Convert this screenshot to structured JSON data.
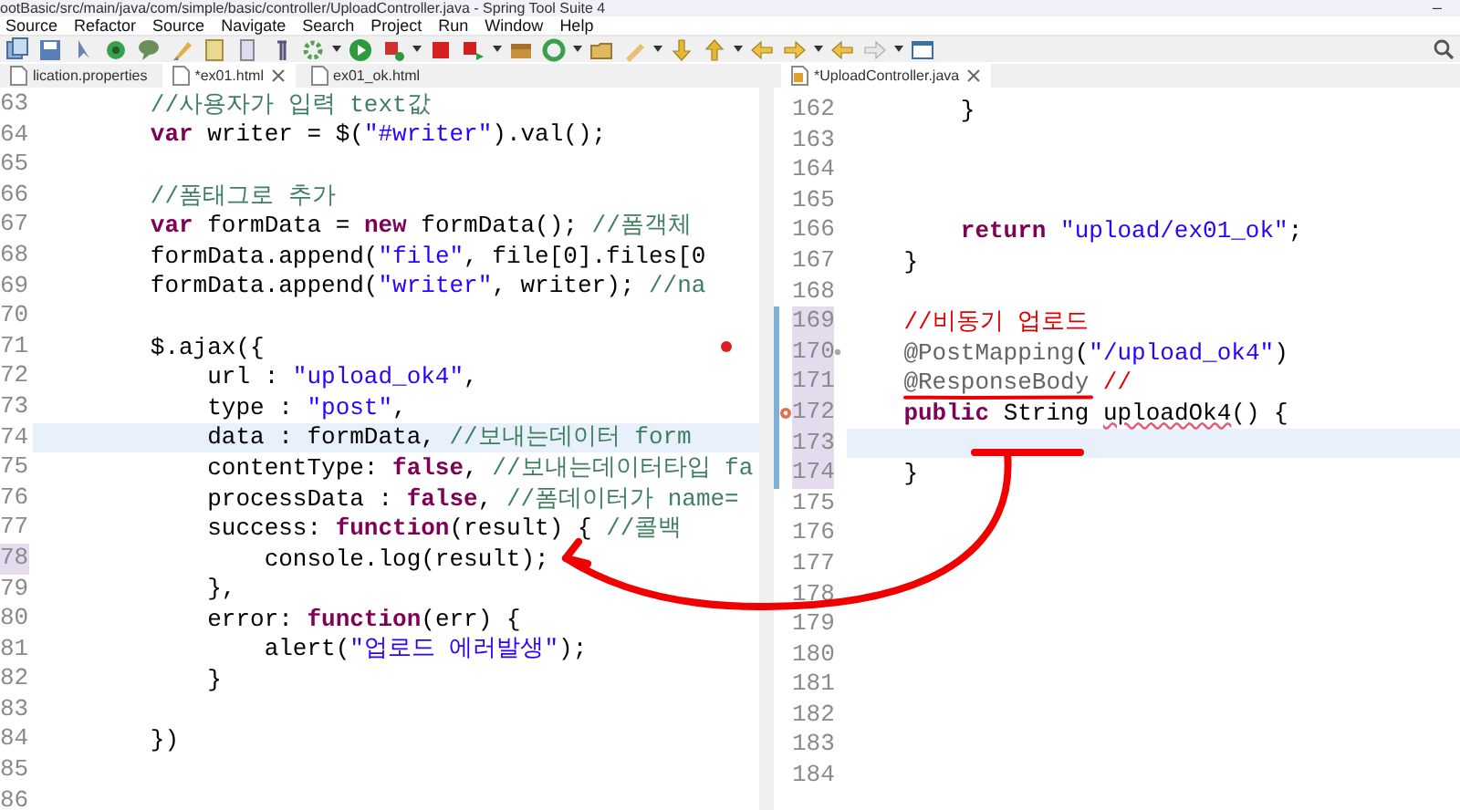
{
  "window": {
    "title": "ootBasic/src/main/java/com/simple/basic/controller/UploadController.java - Spring Tool Suite 4",
    "minimize": "–"
  },
  "menu": [
    "Source",
    "Refactor",
    "Source",
    "Navigate",
    "Search",
    "Project",
    "Run",
    "Window",
    "Help"
  ],
  "editors": [
    {
      "tabs": [
        {
          "label": "lication.properties",
          "selected": false,
          "dirty_close": false
        },
        {
          "label": "*ex01.html",
          "selected": true,
          "dirty_close": true
        },
        {
          "label": "ex01_ok.html",
          "selected": false,
          "dirty_close": false
        }
      ],
      "lines": [
        {
          "number": "63",
          "tokens": [
            {
              "kind": "comment",
              "text": "//사용자가 입력 text값"
            }
          ]
        },
        {
          "number": "64",
          "tokens": [
            {
              "kind": "keyword",
              "text": "var"
            },
            {
              "kind": "plain",
              "text": " writer = $("
            },
            {
              "kind": "string",
              "text": "\"#writer\""
            },
            {
              "kind": "plain",
              "text": ").val();"
            }
          ]
        },
        {
          "number": "65"
        },
        {
          "number": "66",
          "tokens": [
            {
              "kind": "comment",
              "text": "//폼태그로 추가"
            }
          ]
        },
        {
          "number": "67",
          "tokens": [
            {
              "kind": "keyword",
              "text": "var"
            },
            {
              "kind": "plain",
              "text": " formData = "
            },
            {
              "kind": "keyword",
              "text": "new"
            },
            {
              "kind": "plain",
              "text": " formData(); "
            },
            {
              "kind": "comment",
              "text": "//폼객체"
            }
          ]
        },
        {
          "number": "68",
          "tokens": [
            {
              "kind": "plain",
              "text": "formData.append("
            },
            {
              "kind": "string",
              "text": "\"file\""
            },
            {
              "kind": "plain",
              "text": ", file[0].files[0"
            }
          ]
        },
        {
          "number": "69",
          "tokens": [
            {
              "kind": "plain",
              "text": "formData.append("
            },
            {
              "kind": "string",
              "text": "\"writer\""
            },
            {
              "kind": "plain",
              "text": ", writer); "
            },
            {
              "kind": "comment",
              "text": "//na"
            }
          ]
        },
        {
          "number": "70"
        },
        {
          "number": "71",
          "tokens": [
            {
              "kind": "plain",
              "text": "$.ajax({"
            }
          ],
          "children": [
            {
              "number": "72",
              "tokens": [
                {
                  "kind": "plain",
                  "text": "url : "
                },
                {
                  "kind": "string",
                  "text": "\"upload_ok4\""
                },
                {
                  "kind": "plain",
                  "text": ","
                }
              ]
            },
            {
              "number": "73",
              "tokens": [
                {
                  "kind": "plain",
                  "text": "type : "
                },
                {
                  "kind": "string",
                  "text": "\"post\""
                },
                {
                  "kind": "plain",
                  "text": ","
                }
              ]
            },
            {
              "number": "74",
              "current": true,
              "tokens": [
                {
                  "kind": "plain",
                  "text": "data : formData, "
                },
                {
                  "kind": "comment",
                  "text": "//보내는데이터 form"
                }
              ]
            },
            {
              "number": "75",
              "tokens": [
                {
                  "kind": "plain",
                  "text": "contentType: "
                },
                {
                  "kind": "keyword",
                  "text": "false"
                },
                {
                  "kind": "plain",
                  "text": ", "
                },
                {
                  "kind": "comment",
                  "text": "//보내는데이터타입 fa"
                }
              ]
            },
            {
              "number": "76",
              "tokens": [
                {
                  "kind": "plain",
                  "text": "processData : "
                },
                {
                  "kind": "keyword",
                  "text": "false"
                },
                {
                  "kind": "plain",
                  "text": ", "
                },
                {
                  "kind": "comment",
                  "text": "//폼데이터가 name="
                }
              ]
            },
            {
              "number": "77",
              "tokens": [
                {
                  "kind": "plain",
                  "text": "success: "
                },
                {
                  "kind": "keyword",
                  "text": "function"
                },
                {
                  "kind": "plain",
                  "text": "(result) { "
                },
                {
                  "kind": "comment",
                  "text": "//콜백"
                }
              ],
              "children": [
                {
                  "number": "78",
                  "changed": true,
                  "tokens": [
                    {
                      "kind": "plain",
                      "text": "console.log(result);"
                    }
                  ]
                }
              ]
            },
            {
              "number": "79",
              "tokens": [
                {
                  "kind": "plain",
                  "text": "},"
                }
              ]
            },
            {
              "number": "80",
              "tokens": [
                {
                  "kind": "plain",
                  "text": "error: "
                },
                {
                  "kind": "keyword",
                  "text": "function"
                },
                {
                  "kind": "plain",
                  "text": "(err) {"
                }
              ],
              "children": [
                {
                  "number": "81",
                  "tokens": [
                    {
                      "kind": "plain",
                      "text": "alert("
                    },
                    {
                      "kind": "string",
                      "text": "\"업로드 에러발생\""
                    },
                    {
                      "kind": "plain",
                      "text": ");"
                    }
                  ]
                }
              ]
            },
            {
              "number": "82",
              "tokens": [
                {
                  "kind": "plain",
                  "text": "}"
                }
              ]
            },
            {
              "number": "83"
            }
          ]
        },
        {
          "number": "84",
          "tokens": [
            {
              "kind": "plain",
              "text": "})"
            }
          ]
        },
        {
          "number": "85"
        },
        {
          "number": "86"
        }
      ]
    },
    {
      "tabs": [
        {
          "label": "*UploadController.java",
          "selected": true,
          "dirty_close": true
        }
      ],
      "lines": [
        {
          "children": [
            {
              "number": "162",
              "tokens": [
                {
                  "kind": "plain",
                  "text": "}"
                }
              ]
            },
            {
              "number": "163"
            },
            {
              "number": "164"
            },
            {
              "number": "165"
            },
            {
              "number": "166",
              "tokens": [
                {
                  "kind": "keyword",
                  "text": "return "
                },
                {
                  "kind": "string",
                  "text": "\"upload/ex01_ok\""
                },
                {
                  "kind": "plain",
                  "text": ";"
                }
              ]
            }
          ]
        },
        {
          "number": "167",
          "tokens": [
            {
              "kind": "plain",
              "text": "}"
            }
          ]
        },
        {
          "number": "168"
        },
        {
          "number": "169",
          "changed": true,
          "tokens": [
            {
              "kind": "red",
              "text": "//비동기 업로드"
            }
          ]
        },
        {
          "number": "170",
          "changed": true,
          "fold_dot": true,
          "tokens": [
            {
              "kind": "annotation",
              "text": "@PostMapping"
            },
            {
              "kind": "plain",
              "text": "("
            },
            {
              "kind": "string",
              "text": "\"/upload_ok4\""
            },
            {
              "kind": "plain",
              "text": ")"
            }
          ]
        },
        {
          "number": "171",
          "changed": true,
          "tokens": [
            {
              "kind": "annotation",
              "text": "@ResponseBody "
            },
            {
              "kind": "red",
              "text": "//"
            }
          ]
        },
        {
          "number": "172",
          "changed": true,
          "warning": true,
          "tokens": [
            {
              "kind": "keyword",
              "text": "public"
            },
            {
              "kind": "plain",
              "text": " String "
            },
            {
              "kind": "squiggle",
              "text": "uploadOk4"
            },
            {
              "kind": "plain",
              "text": "() {"
            }
          ]
        },
        {
          "number": "173",
          "changed": true,
          "current": true
        },
        {
          "number": "174",
          "changed": true,
          "tokens": [
            {
              "kind": "plain",
              "text": "}"
            }
          ]
        },
        {
          "number": "175"
        },
        {
          "number": "176"
        },
        {
          "number": "177"
        },
        {
          "number": "178"
        },
        {
          "number": "179"
        },
        {
          "number": "180"
        },
        {
          "number": "181"
        },
        {
          "number": "182"
        },
        {
          "number": "183"
        },
        {
          "number": "184"
        }
      ]
    }
  ]
}
